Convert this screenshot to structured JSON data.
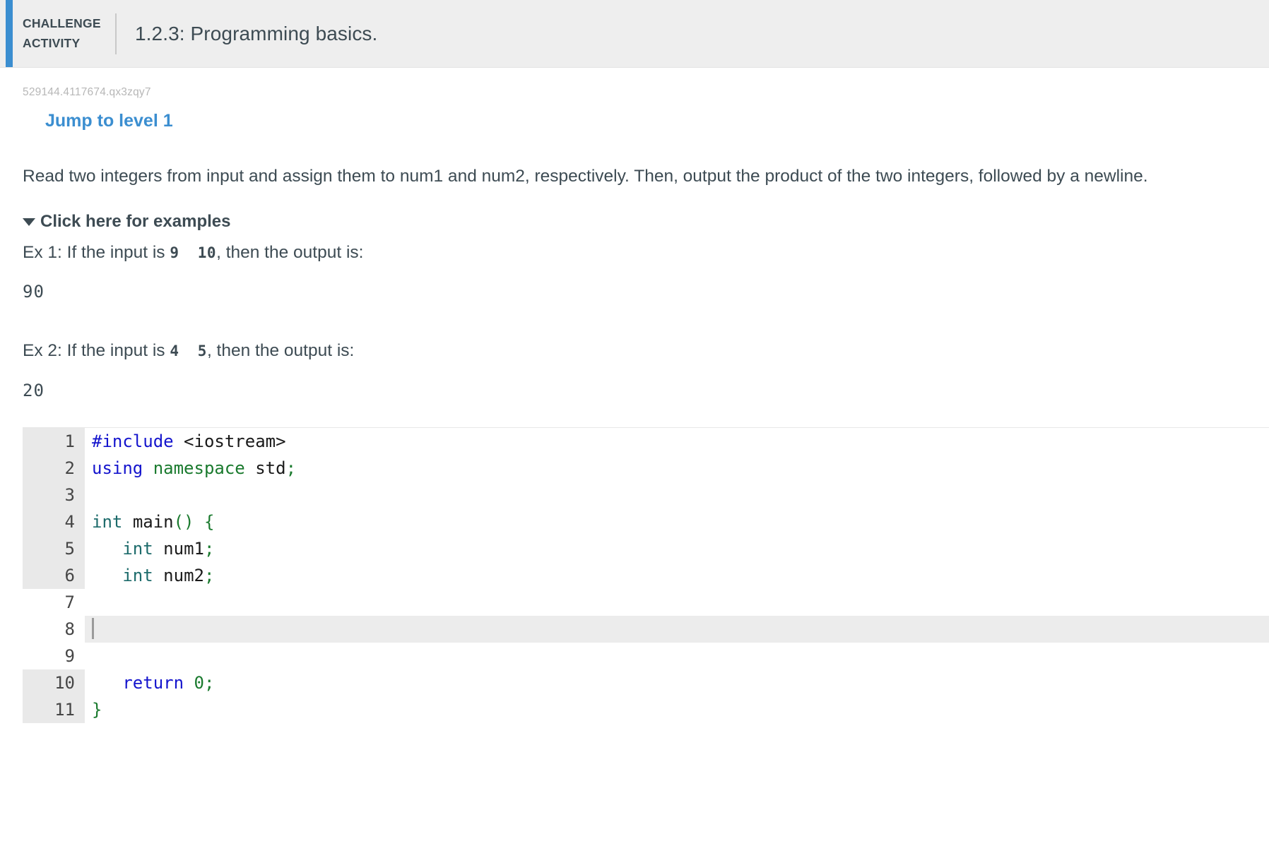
{
  "header": {
    "kicker_line1": "CHALLENGE",
    "kicker_line2": "ACTIVITY",
    "title": "1.2.3: Programming basics.",
    "accent_color": "#3b8ed0",
    "background_color": "#eeeeee"
  },
  "activity": {
    "id": "529144.4117674.qx3zqy7",
    "level_link": "Jump to level 1",
    "level_link_color": "#3b8ed0",
    "prompt": "Read two integers from input and assign them to num1 and num2, respectively. Then, output the product of the two integers, followed by a newline."
  },
  "examples": {
    "toggle_label": "Click here for examples",
    "toggle_icon": "caret-down-icon",
    "items": [
      {
        "prefix": "Ex 1: If the input is ",
        "input": "9  10",
        "suffix": ", then the output is:",
        "output": "90"
      },
      {
        "prefix": "Ex 2: If the input is ",
        "input": "4  5",
        "suffix": ", then the output is:",
        "output": "20"
      }
    ]
  },
  "editor": {
    "active_line": 8,
    "gutter_color": "#e9e9e9",
    "active_line_color": "#ececec",
    "lines": [
      {
        "n": "1",
        "shaded": true,
        "tokens": [
          {
            "t": "#include",
            "c": "tok-pre"
          },
          {
            "t": " ",
            "c": "tok-plain"
          },
          {
            "t": "<iostream>",
            "c": "tok-plain"
          }
        ]
      },
      {
        "n": "2",
        "shaded": true,
        "tokens": [
          {
            "t": "using",
            "c": "tok-kw"
          },
          {
            "t": " ",
            "c": "tok-plain"
          },
          {
            "t": "namespace",
            "c": "tok-ns"
          },
          {
            "t": " ",
            "c": "tok-plain"
          },
          {
            "t": "std",
            "c": "tok-plain"
          },
          {
            "t": ";",
            "c": "tok-punct"
          }
        ]
      },
      {
        "n": "3",
        "shaded": true,
        "tokens": []
      },
      {
        "n": "4",
        "shaded": true,
        "tokens": [
          {
            "t": "int",
            "c": "tok-type"
          },
          {
            "t": " ",
            "c": "tok-plain"
          },
          {
            "t": "main",
            "c": "tok-plain"
          },
          {
            "t": "()",
            "c": "tok-punct"
          },
          {
            "t": " ",
            "c": "tok-plain"
          },
          {
            "t": "{",
            "c": "tok-punct"
          }
        ]
      },
      {
        "n": "5",
        "shaded": true,
        "tokens": [
          {
            "t": "   ",
            "c": "tok-plain"
          },
          {
            "t": "int",
            "c": "tok-type"
          },
          {
            "t": " ",
            "c": "tok-plain"
          },
          {
            "t": "num1",
            "c": "tok-plain"
          },
          {
            "t": ";",
            "c": "tok-punct"
          }
        ]
      },
      {
        "n": "6",
        "shaded": true,
        "tokens": [
          {
            "t": "   ",
            "c": "tok-plain"
          },
          {
            "t": "int",
            "c": "tok-type"
          },
          {
            "t": " ",
            "c": "tok-plain"
          },
          {
            "t": "num2",
            "c": "tok-plain"
          },
          {
            "t": ";",
            "c": "tok-punct"
          }
        ]
      },
      {
        "n": "7",
        "shaded": false,
        "tokens": []
      },
      {
        "n": "8",
        "shaded": false,
        "tokens": [],
        "active": true
      },
      {
        "n": "9",
        "shaded": false,
        "tokens": []
      },
      {
        "n": "10",
        "shaded": true,
        "tokens": [
          {
            "t": "   ",
            "c": "tok-plain"
          },
          {
            "t": "return",
            "c": "tok-kw"
          },
          {
            "t": " ",
            "c": "tok-plain"
          },
          {
            "t": "0",
            "c": "tok-num"
          },
          {
            "t": ";",
            "c": "tok-punct"
          }
        ]
      },
      {
        "n": "11",
        "shaded": true,
        "tokens": [
          {
            "t": "}",
            "c": "tok-punct"
          }
        ]
      },
      {
        "n": "",
        "shaded": true,
        "tokens": []
      },
      {
        "n": "",
        "shaded": true,
        "tokens": []
      }
    ]
  }
}
